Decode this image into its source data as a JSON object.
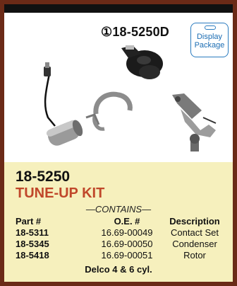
{
  "product": {
    "catalog_number": "①18-5250D",
    "badge": {
      "line1": "Display",
      "line2": "Package"
    },
    "part_number": "18-5250",
    "title": "TUNE-UP KIT",
    "contains_label": "—CONTAINS—",
    "columns": [
      "Part #",
      "O.E. #",
      "Description"
    ],
    "items": [
      {
        "part": "18-5311",
        "oe": "16.69-00049",
        "description": "Contact Set"
      },
      {
        "part": "18-5345",
        "oe": "16.69-00050",
        "description": "Condenser"
      },
      {
        "part": "18-5418",
        "oe": "16.69-00051",
        "description": "Rotor"
      }
    ],
    "application": "Delco 4 & 6 cyl."
  },
  "colors": {
    "border": "#6b2a17",
    "panel": "#f6f0bd",
    "title_accent": "#c0472a",
    "badge_blue": "#2a7bbf"
  },
  "icons": [
    "condenser-image",
    "rotor-image",
    "clip-image",
    "contact-set-image",
    "display-package-badge"
  ]
}
